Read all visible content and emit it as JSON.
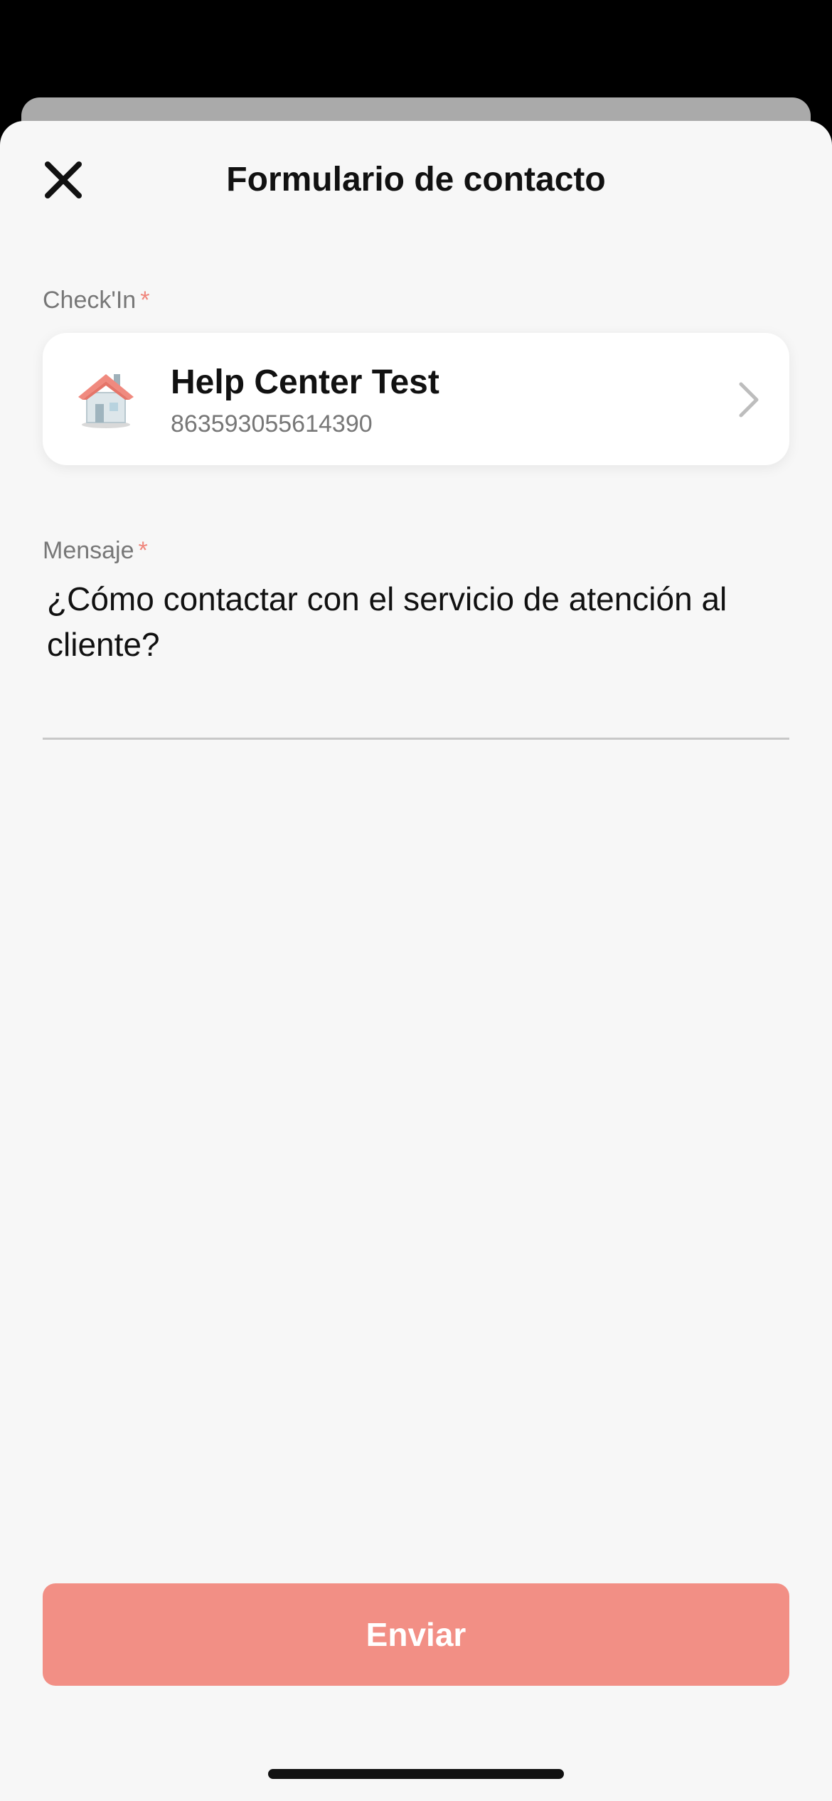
{
  "sheet": {
    "title": "Formulario de contacto"
  },
  "checkin": {
    "label": "Check'In",
    "required_mark": "*",
    "property_name": "Help Center Test",
    "property_id": "863593055614390"
  },
  "message": {
    "label": "Mensaje",
    "required_mark": "*",
    "value": "¿Cómo contactar con el servicio de atención al cliente?"
  },
  "submit": {
    "label": "Enviar"
  },
  "icons": {
    "close": "close-icon",
    "house": "house-icon",
    "chevron": "chevron-right-icon"
  },
  "colors": {
    "accent": "#f28f85",
    "required": "#f0867c",
    "background": "#f7f7f7"
  }
}
